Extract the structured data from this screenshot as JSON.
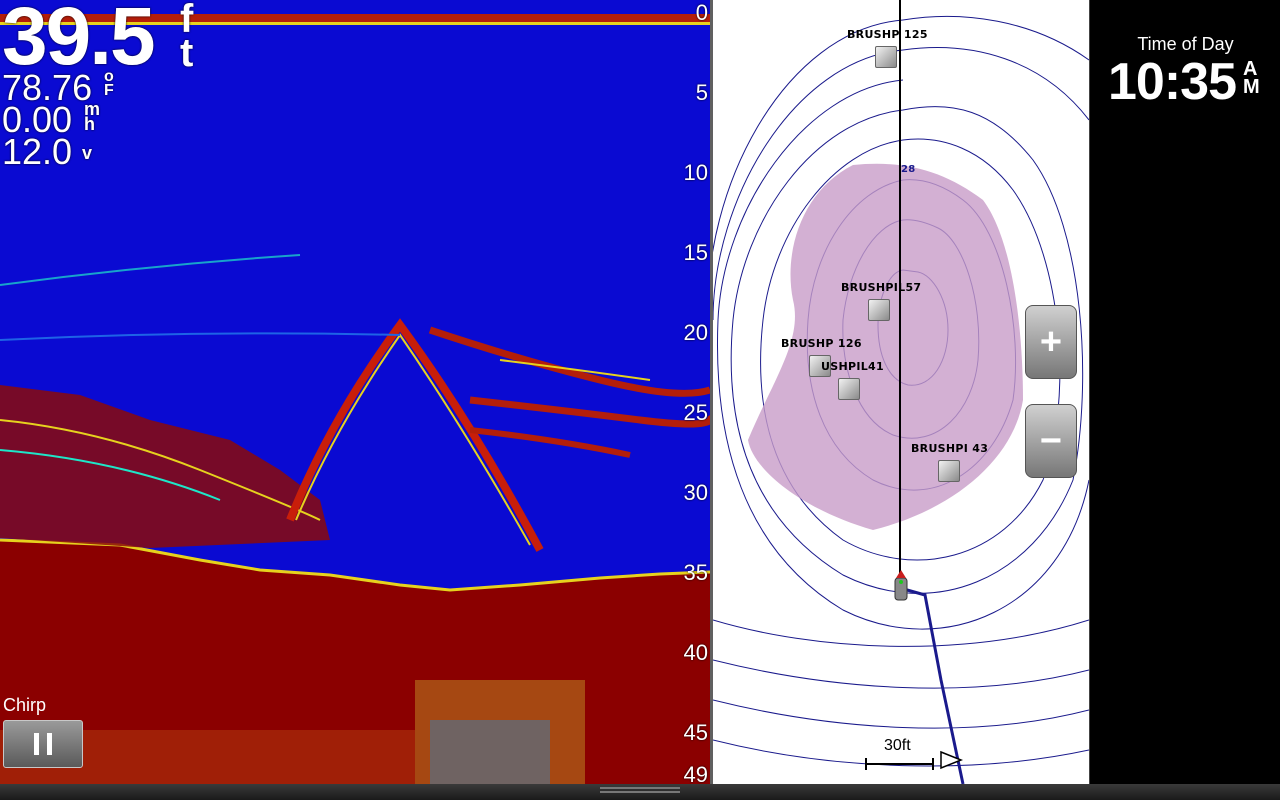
{
  "sonar": {
    "depth": "39.5",
    "depth_unit": [
      "f",
      "t"
    ],
    "temperature": "78.76",
    "temperature_unit": [
      "o",
      "F"
    ],
    "speed": "0.00",
    "speed_unit": [
      "m",
      "h"
    ],
    "voltage": "12.0",
    "voltage_unit": "v",
    "depth_scale": [
      "0",
      "5",
      "10",
      "15",
      "20",
      "25",
      "30",
      "35",
      "40",
      "45",
      "49"
    ],
    "mode_label": "Chirp"
  },
  "chart": {
    "contour_label": "28",
    "waypoints": [
      "BRUSHP 125",
      "BRUSHPIL57",
      "BRUSHP 126",
      "USHPIL41",
      "BRUSHPI 43"
    ],
    "zoom_in_glyph": "+",
    "zoom_out_glyph": "−",
    "scale": "30ft"
  },
  "data_panel": {
    "label": "Time of Day",
    "time": "10:35",
    "ampm": [
      "A",
      "M"
    ]
  },
  "colors": {
    "water": "#0a0ad2",
    "bottom": "#8b0000",
    "return": "#c81e0a",
    "chart_bg": "#ffffff",
    "contour": "#1a1a8c",
    "shallow_area": "#c89cc8"
  }
}
